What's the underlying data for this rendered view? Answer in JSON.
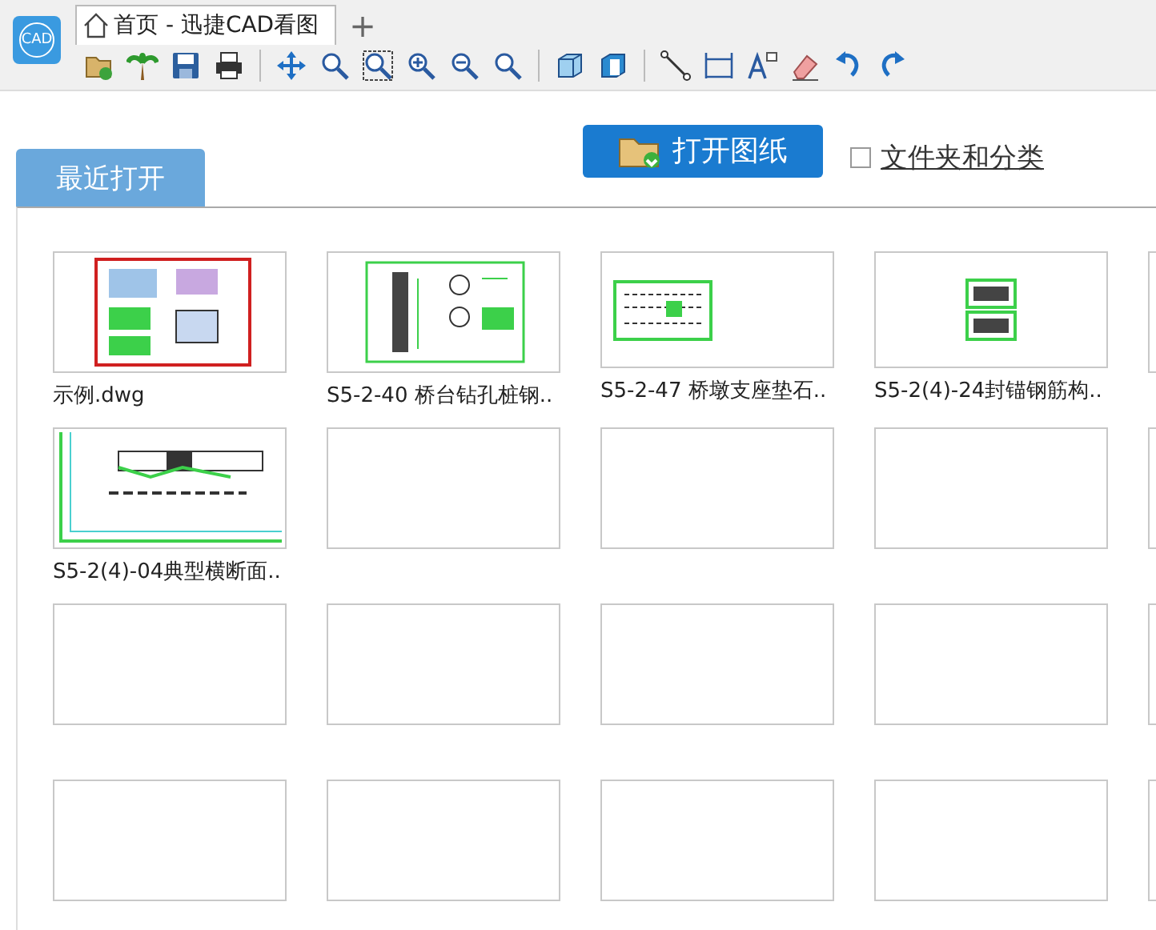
{
  "app": {
    "logo": "CAD"
  },
  "tabs": [
    {
      "label": "首页 - 迅捷CAD看图",
      "selected": true
    }
  ],
  "new_tab": "+",
  "open_button": "打开图纸",
  "folder_option": {
    "label": "文件夹和分类",
    "checked": false
  },
  "section_tab": {
    "label": "最近打开",
    "selected": true
  },
  "rows": [
    [
      {
        "kind": "file",
        "name": "示例.dwg"
      },
      {
        "kind": "file",
        "name": "S5-2-40 桥台钻孔桩钢.."
      },
      {
        "kind": "file",
        "name": "S5-2-47 桥墩支座垫石.."
      },
      {
        "kind": "file",
        "name": "S5-2(4)-24封锚钢筋构.."
      },
      {
        "kind": "empty"
      }
    ],
    [
      {
        "kind": "file",
        "name": "S5-2(4)-04典型横断面.."
      },
      {
        "kind": "empty"
      },
      {
        "kind": "empty"
      },
      {
        "kind": "empty"
      },
      {
        "kind": "empty"
      }
    ],
    [
      {
        "kind": "empty"
      },
      {
        "kind": "empty"
      },
      {
        "kind": "empty"
      },
      {
        "kind": "empty"
      },
      {
        "kind": "empty"
      }
    ],
    [
      {
        "kind": "empty"
      },
      {
        "kind": "empty"
      },
      {
        "kind": "empty"
      },
      {
        "kind": "empty"
      },
      {
        "kind": "empty"
      }
    ]
  ]
}
